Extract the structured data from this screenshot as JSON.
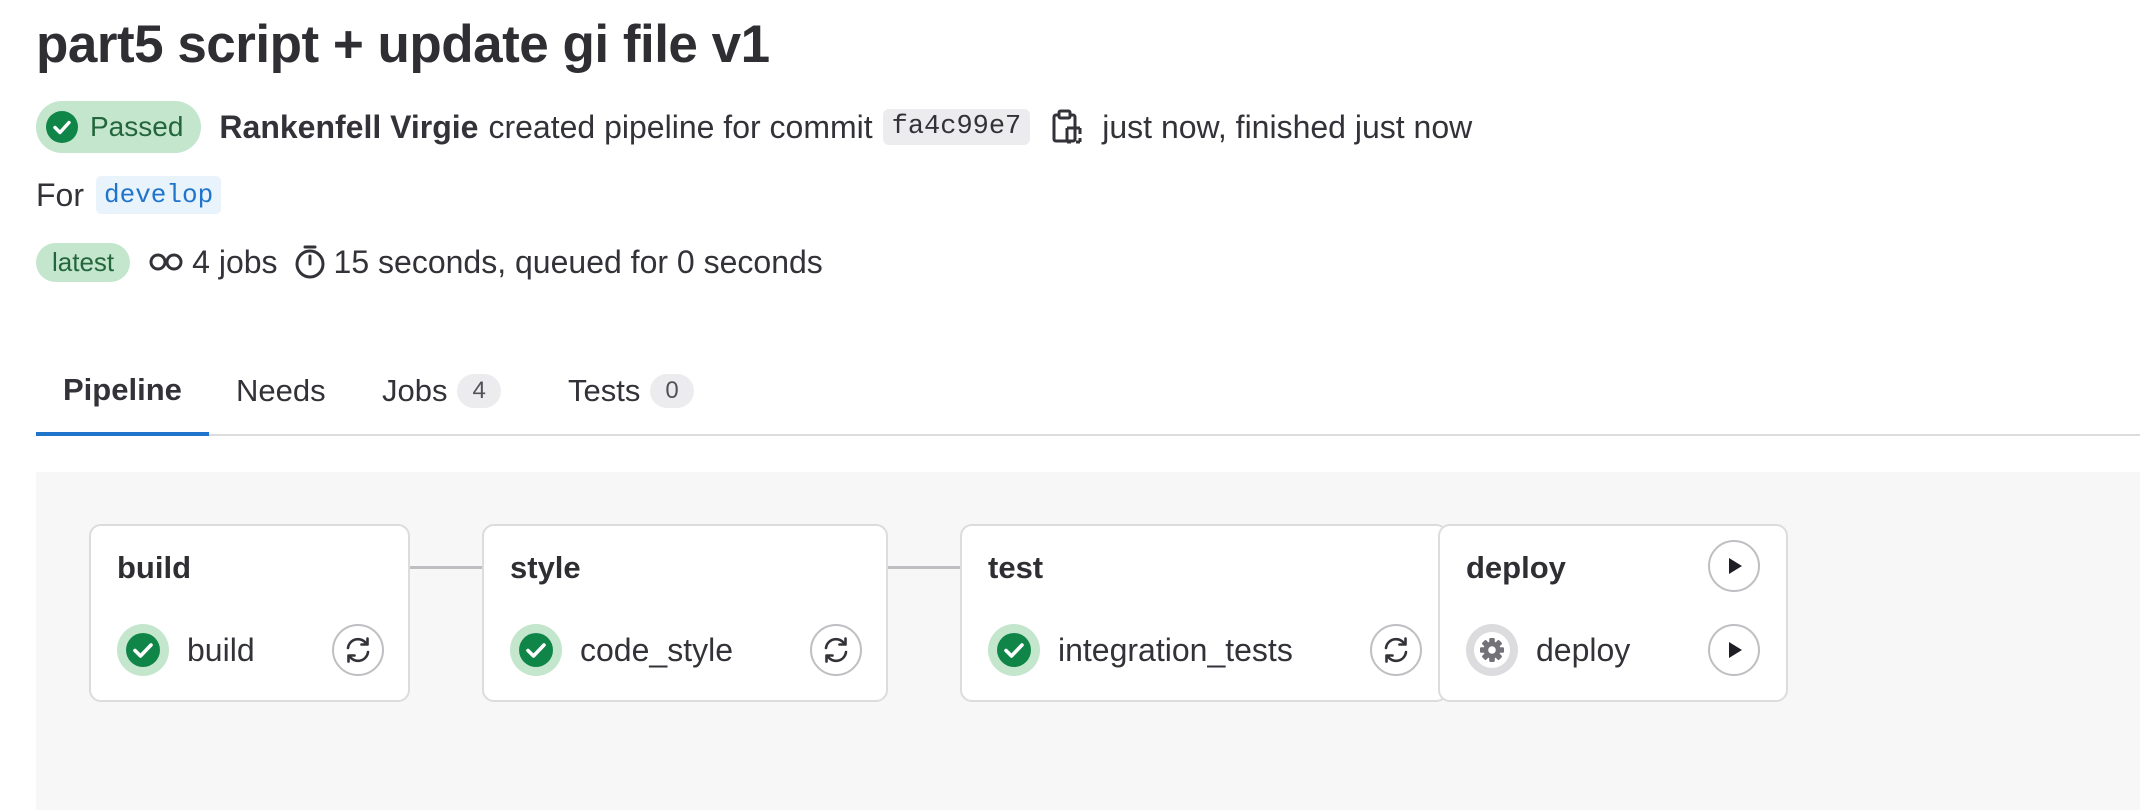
{
  "pipeline": {
    "title": "part5 script + update gi file v1",
    "status": "Passed",
    "author": "Rankenfell Virgie",
    "created_text": "created pipeline for commit",
    "commit_sha": "fa4c99e7",
    "time_text": "just now, finished just now",
    "for_label": "For",
    "ref": "develop",
    "latest_label": "latest",
    "jobs_text": "4 jobs",
    "duration_text": "15 seconds, queued for 0 seconds"
  },
  "tabs": [
    {
      "label": "Pipeline",
      "active": true
    },
    {
      "label": "Needs"
    },
    {
      "label": "Jobs",
      "count": "4"
    },
    {
      "label": "Tests",
      "count": "0"
    }
  ],
  "stages": [
    {
      "name": "build",
      "job": "build",
      "job_status": "success",
      "action": "retry"
    },
    {
      "name": "style",
      "job": "code_style",
      "job_status": "success",
      "action": "retry"
    },
    {
      "name": "test",
      "job": "integration_tests",
      "job_status": "success",
      "action": "retry"
    },
    {
      "name": "deploy",
      "job": "deploy",
      "job_status": "manual",
      "action": "play"
    }
  ],
  "colors": {
    "success": "#108548",
    "success_bg": "#c3e6cd",
    "link": "#1f75cb",
    "tab_underline": "#1f75cb"
  }
}
